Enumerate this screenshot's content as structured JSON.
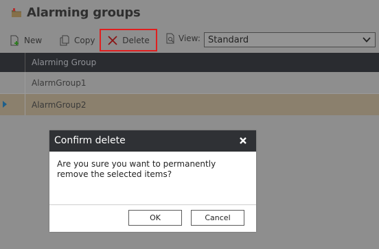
{
  "page": {
    "title": "Alarming groups",
    "title_icon": "folder-alarm-icon"
  },
  "toolbar": {
    "new_label": "New",
    "copy_label": "Copy",
    "delete_label": "Delete",
    "view_label": "View:",
    "view_value": "Standard"
  },
  "grid": {
    "column_header": "Alarming Group",
    "rows": [
      {
        "name": "AlarmGroup1",
        "selected": false
      },
      {
        "name": "AlarmGroup2",
        "selected": true
      }
    ]
  },
  "dialog": {
    "title": "Confirm delete",
    "message": "Are you sure you want to permanently remove the selected items?",
    "ok_label": "OK",
    "cancel_label": "Cancel"
  },
  "colors": {
    "highlight_border": "#e01e1e",
    "selected_row": "#8b806d",
    "header_dark": "#2a2c30",
    "overlay_gray": "#8e8e8e"
  }
}
